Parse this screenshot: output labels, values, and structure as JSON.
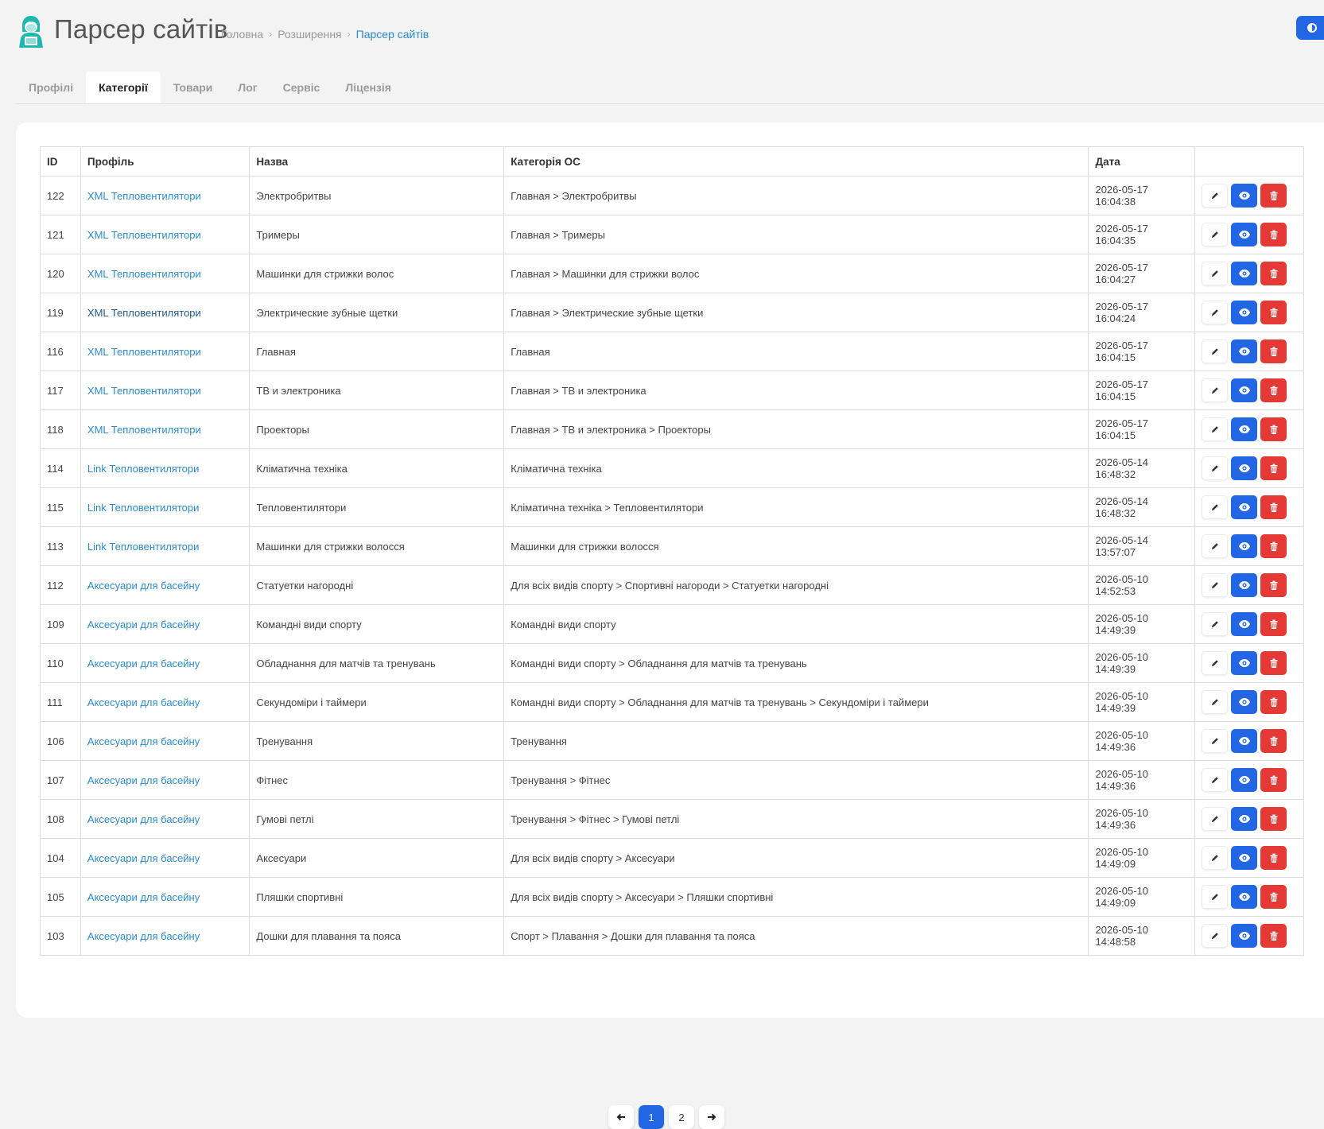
{
  "header": {
    "app_title": "Парсер сайтів",
    "breadcrumb": [
      "Головна",
      "Розширення",
      "Парсер сайтів"
    ],
    "breadcrumb_separator": "›"
  },
  "tabs": [
    "Профілі",
    "Категорії",
    "Товари",
    "Лог",
    "Сервіс",
    "Ліцензія"
  ],
  "active_tab": "Категорії",
  "table": {
    "columns": [
      "ID",
      "Профіль",
      "Назва",
      "Категорія ОС",
      "Дата",
      ""
    ],
    "rows": [
      {
        "id": "122",
        "profile": "XML Тепловентилятори",
        "name": "Электробритвы",
        "category": "Главная > Электробритвы",
        "date": "2026-05-17 16:04:38"
      },
      {
        "id": "121",
        "profile": "XML Тепловентилятори",
        "name": "Тримеры",
        "category": "Главная > Тримеры",
        "date": "2026-05-17 16:04:35"
      },
      {
        "id": "120",
        "profile": "XML Тепловентилятори",
        "name": "Машинки для стрижки волос",
        "category": "Главная > Машинки для стрижки волос",
        "date": "2026-05-17 16:04:27"
      },
      {
        "id": "119",
        "profile": "XML Тепловентилятори",
        "name": "Электрические зубные щетки",
        "category": "Главная > Электрические зубные щетки",
        "date": "2026-05-17 16:04:24"
      },
      {
        "id": "116",
        "profile": "XML Тепловентилятори",
        "name": "Главная",
        "category": "Главная",
        "date": "2026-05-17 16:04:15"
      },
      {
        "id": "117",
        "profile": "XML Тепловентилятори",
        "name": "ТВ и электроника",
        "category": "Главная > ТВ и электроника",
        "date": "2026-05-17 16:04:15"
      },
      {
        "id": "118",
        "profile": "XML Тепловентилятори",
        "name": "Проекторы",
        "category": "Главная > ТВ и электроника > Проекторы",
        "date": "2026-05-17 16:04:15"
      },
      {
        "id": "114",
        "profile": "Link Тепловентилятори",
        "name": "Кліматична техніка",
        "category": "Кліматична техніка",
        "date": "2026-05-14 16:48:32"
      },
      {
        "id": "115",
        "profile": "Link Тепловентилятори",
        "name": "Тепловентилятори",
        "category": "Кліматична техніка > Тепловентилятори",
        "date": "2026-05-14 16:48:32"
      },
      {
        "id": "113",
        "profile": "Link Тепловентилятори",
        "name": "Машинки для стрижки волосся",
        "category": "Машинки для стрижки волосся",
        "date": "2026-05-14 13:57:07"
      },
      {
        "id": "112",
        "profile": "Аксесуари для басейну",
        "name": "Статуетки нагородні",
        "category": "Для всіх видів спорту > Спортивні нагороди > Статуетки нагородні",
        "date": "2026-05-10 14:52:53"
      },
      {
        "id": "109",
        "profile": "Аксесуари для басейну",
        "name": "Командні види спорту",
        "category": "Командні види спорту",
        "date": "2026-05-10 14:49:39"
      },
      {
        "id": "110",
        "profile": "Аксесуари для басейну",
        "name": "Обладнання для матчів та тренувань",
        "category": "Командні види спорту > Обладнання для матчів та тренувань",
        "date": "2026-05-10 14:49:39"
      },
      {
        "id": "111",
        "profile": "Аксесуари для басейну",
        "name": "Секундоміри і таймери",
        "category": "Командні види спорту > Обладнання для матчів та тренувань > Секундоміри і таймери",
        "date": "2026-05-10 14:49:39"
      },
      {
        "id": "106",
        "profile": "Аксесуари для басейну",
        "name": "Тренування",
        "category": "Тренування",
        "date": "2026-05-10 14:49:36"
      },
      {
        "id": "107",
        "profile": "Аксесуари для басейну",
        "name": "Фітнес",
        "category": "Тренування > Фітнес",
        "date": "2026-05-10 14:49:36"
      },
      {
        "id": "108",
        "profile": "Аксесуари для басейну",
        "name": "Гумові петлі",
        "category": "Тренування > Фітнес > Гумові петлі",
        "date": "2026-05-10 14:49:36"
      },
      {
        "id": "104",
        "profile": "Аксесуари для басейну",
        "name": "Аксесуари",
        "category": "Для всіх видів спорту > Аксесуари",
        "date": "2026-05-10 14:49:09"
      },
      {
        "id": "105",
        "profile": "Аксесуари для басейну",
        "name": "Пляшки спортивні",
        "category": "Для всіх видів спорту > Аксесуари > Пляшки спортивні",
        "date": "2026-05-10 14:49:09"
      },
      {
        "id": "103",
        "profile": "Аксесуари для басейну",
        "name": "Дошки для плавання та пояса",
        "category": "Спорт > Плавання > Дошки для плавання та пояса",
        "date": "2026-05-10 14:48:58"
      }
    ]
  },
  "pagination": {
    "prev_icon": "arrow-left-icon",
    "pages": [
      "1",
      "2"
    ],
    "current_page": "1",
    "next_icon": "arrow-right-icon"
  },
  "colors": {
    "primary": "#2266e3",
    "danger": "#e53935",
    "link": "#2a8bd0",
    "logo": "#1fb8b0"
  },
  "icons": {
    "logo": "hacker-avatar-icon",
    "theme_toggle": "contrast-icon",
    "edit": "pencil-icon",
    "view": "eye-icon",
    "delete": "trash-icon"
  }
}
